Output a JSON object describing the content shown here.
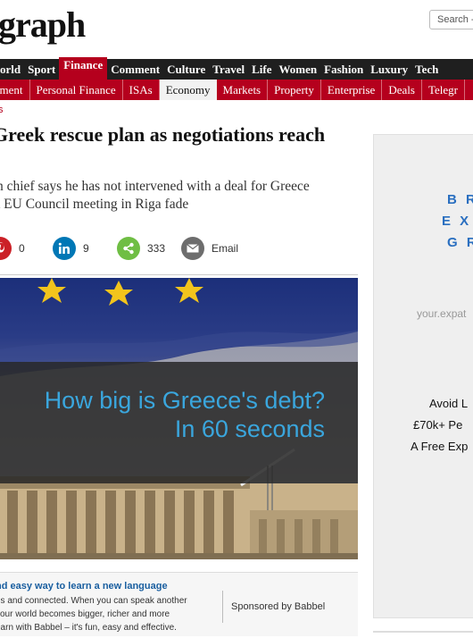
{
  "masthead": {
    "logo": "graph",
    "search_label": "Search -"
  },
  "nav_primary": [
    {
      "label": "orld"
    },
    {
      "label": "Sport"
    },
    {
      "label": "Finance",
      "active": true
    },
    {
      "label": "Comment"
    },
    {
      "label": "Culture"
    },
    {
      "label": "Travel"
    },
    {
      "label": "Life"
    },
    {
      "label": "Women"
    },
    {
      "label": "Fashion"
    },
    {
      "label": "Luxury"
    },
    {
      "label": "Tech"
    }
  ],
  "nav_secondary": [
    {
      "label": "nment"
    },
    {
      "label": "Personal Finance"
    },
    {
      "label": "ISAs"
    },
    {
      "label": "Economy",
      "active": true
    },
    {
      "label": "Markets"
    },
    {
      "label": "Property"
    },
    {
      "label": "Enterprise"
    },
    {
      "label": "Deals"
    },
    {
      "label": "Telegr"
    }
  ],
  "article": {
    "section": "s",
    "headline": "Greek rescue plan as negotiations reach",
    "standfirst_line1": "n chief says he has not intervened with a deal for Greece",
    "standfirst_line2": "t EU Council meeting in Riga fade"
  },
  "share": {
    "pinterest_count": "0",
    "linkedin_count": "9",
    "share_count": "333",
    "email_label": "Email",
    "colors": {
      "pinterest": "#cb2027",
      "linkedin": "#0077b5",
      "share": "#6fbe44",
      "email": "#6d6d6d"
    }
  },
  "video": {
    "caption_line1": "How big is Greece's debt?",
    "caption_line2": "In 60 seconds"
  },
  "sponsored": {
    "title": "nd easy way to learn a new language",
    "body_line1": "us and connected. When you can speak another",
    "body_line2": "your world becomes bigger, richer and more",
    "body_line3": "earn with Babbel – it's fun, easy and effective.",
    "by": "Sponsored by Babbel"
  },
  "ad": {
    "line1": "B R",
    "line2": "E X",
    "line3": "G R",
    "url": "your.expat",
    "text1": "Avoid L",
    "text2": "£70k+ Pe",
    "text3": "A Free Exp"
  }
}
